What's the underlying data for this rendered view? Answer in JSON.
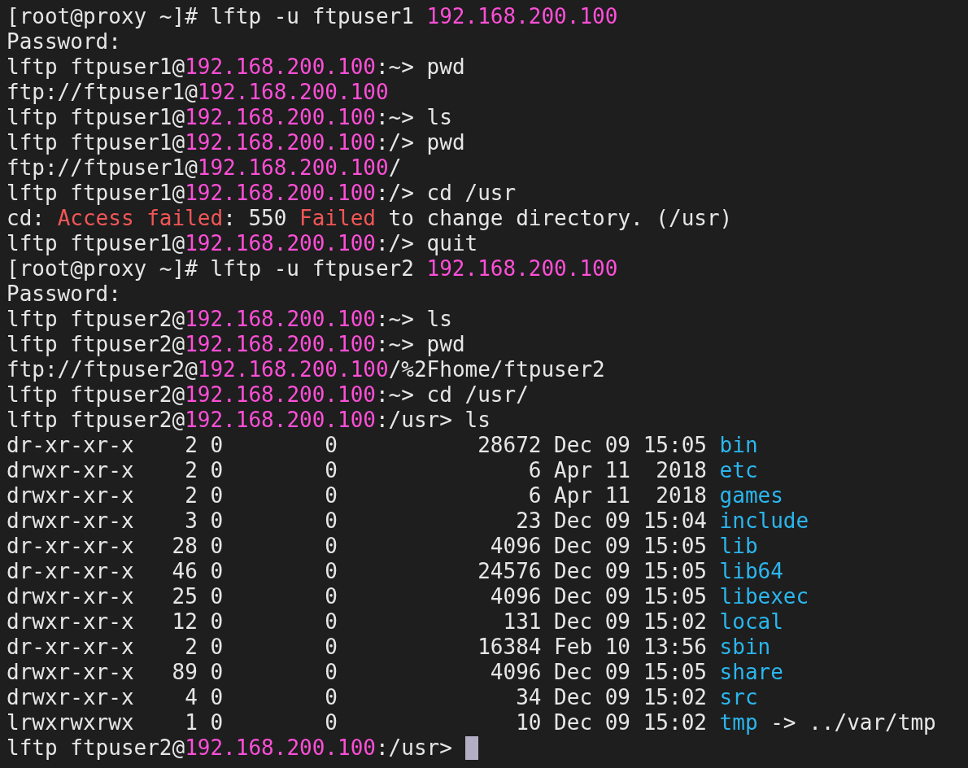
{
  "terminal": {
    "lines": [
      {
        "segments": [
          {
            "text": "[root@proxy ~]# lftp -u ftpuser1 ",
            "kind": "plain"
          },
          {
            "text": "192.168.200.100",
            "kind": "ip"
          }
        ]
      },
      {
        "segments": [
          {
            "text": "Password:",
            "kind": "plain"
          }
        ]
      },
      {
        "segments": [
          {
            "text": "lftp ftpuser1@",
            "kind": "plain"
          },
          {
            "text": "192.168.200.100",
            "kind": "ip"
          },
          {
            "text": ":~> pwd",
            "kind": "plain"
          }
        ]
      },
      {
        "segments": [
          {
            "text": "ftp://ftpuser1@",
            "kind": "plain"
          },
          {
            "text": "192.168.200.100",
            "kind": "ip"
          }
        ]
      },
      {
        "segments": [
          {
            "text": "lftp ftpuser1@",
            "kind": "plain"
          },
          {
            "text": "192.168.200.100",
            "kind": "ip"
          },
          {
            "text": ":~> ls",
            "kind": "plain"
          }
        ]
      },
      {
        "segments": [
          {
            "text": "lftp ftpuser1@",
            "kind": "plain"
          },
          {
            "text": "192.168.200.100",
            "kind": "ip"
          },
          {
            "text": ":/> pwd",
            "kind": "plain"
          }
        ]
      },
      {
        "segments": [
          {
            "text": "ftp://ftpuser1@",
            "kind": "plain"
          },
          {
            "text": "192.168.200.100",
            "kind": "ip"
          },
          {
            "text": "/",
            "kind": "plain"
          }
        ]
      },
      {
        "segments": [
          {
            "text": "lftp ftpuser1@",
            "kind": "plain"
          },
          {
            "text": "192.168.200.100",
            "kind": "ip"
          },
          {
            "text": ":/> cd /usr",
            "kind": "plain"
          }
        ]
      },
      {
        "segments": [
          {
            "text": "cd: ",
            "kind": "plain"
          },
          {
            "text": "Access failed",
            "kind": "error"
          },
          {
            "text": ": 550 ",
            "kind": "plain"
          },
          {
            "text": "Failed",
            "kind": "error"
          },
          {
            "text": " to change directory. (/usr)",
            "kind": "plain"
          }
        ]
      },
      {
        "segments": [
          {
            "text": "lftp ftpuser1@",
            "kind": "plain"
          },
          {
            "text": "192.168.200.100",
            "kind": "ip"
          },
          {
            "text": ":/> quit",
            "kind": "plain"
          }
        ]
      },
      {
        "segments": [
          {
            "text": "[root@proxy ~]# lftp -u ftpuser2 ",
            "kind": "plain"
          },
          {
            "text": "192.168.200.100",
            "kind": "ip"
          }
        ]
      },
      {
        "segments": [
          {
            "text": "Password:",
            "kind": "plain"
          }
        ]
      },
      {
        "segments": [
          {
            "text": "lftp ftpuser2@",
            "kind": "plain"
          },
          {
            "text": "192.168.200.100",
            "kind": "ip"
          },
          {
            "text": ":~> ls",
            "kind": "plain"
          }
        ]
      },
      {
        "segments": [
          {
            "text": "lftp ftpuser2@",
            "kind": "plain"
          },
          {
            "text": "192.168.200.100",
            "kind": "ip"
          },
          {
            "text": ":~> pwd",
            "kind": "plain"
          }
        ]
      },
      {
        "segments": [
          {
            "text": "ftp://ftpuser2@",
            "kind": "plain"
          },
          {
            "text": "192.168.200.100",
            "kind": "ip"
          },
          {
            "text": "/%2Fhome/ftpuser2",
            "kind": "plain"
          }
        ]
      },
      {
        "segments": [
          {
            "text": "lftp ftpuser2@",
            "kind": "plain"
          },
          {
            "text": "192.168.200.100",
            "kind": "ip"
          },
          {
            "text": ":~> cd /usr/",
            "kind": "plain"
          }
        ]
      },
      {
        "segments": [
          {
            "text": "lftp ftpuser2@",
            "kind": "plain"
          },
          {
            "text": "192.168.200.100",
            "kind": "ip"
          },
          {
            "text": ":/usr> ls",
            "kind": "plain"
          }
        ]
      },
      {
        "segments": [
          {
            "text": "dr-xr-xr-x    2 0        0           28672 Dec 09 15:05 ",
            "kind": "plain"
          },
          {
            "text": "bin",
            "kind": "dir"
          }
        ]
      },
      {
        "segments": [
          {
            "text": "drwxr-xr-x    2 0        0               6 Apr 11  2018 ",
            "kind": "plain"
          },
          {
            "text": "etc",
            "kind": "dir"
          }
        ]
      },
      {
        "segments": [
          {
            "text": "drwxr-xr-x    2 0        0               6 Apr 11  2018 ",
            "kind": "plain"
          },
          {
            "text": "games",
            "kind": "dir"
          }
        ]
      },
      {
        "segments": [
          {
            "text": "drwxr-xr-x    3 0        0              23 Dec 09 15:04 ",
            "kind": "plain"
          },
          {
            "text": "include",
            "kind": "dir"
          }
        ]
      },
      {
        "segments": [
          {
            "text": "dr-xr-xr-x   28 0        0            4096 Dec 09 15:05 ",
            "kind": "plain"
          },
          {
            "text": "lib",
            "kind": "dir"
          }
        ]
      },
      {
        "segments": [
          {
            "text": "dr-xr-xr-x   46 0        0           24576 Dec 09 15:05 ",
            "kind": "plain"
          },
          {
            "text": "lib64",
            "kind": "dir"
          }
        ]
      },
      {
        "segments": [
          {
            "text": "drwxr-xr-x   25 0        0            4096 Dec 09 15:05 ",
            "kind": "plain"
          },
          {
            "text": "libexec",
            "kind": "dir"
          }
        ]
      },
      {
        "segments": [
          {
            "text": "drwxr-xr-x   12 0        0             131 Dec 09 15:02 ",
            "kind": "plain"
          },
          {
            "text": "local",
            "kind": "dir"
          }
        ]
      },
      {
        "segments": [
          {
            "text": "dr-xr-xr-x    2 0        0           16384 Feb 10 13:56 ",
            "kind": "plain"
          },
          {
            "text": "sbin",
            "kind": "dir"
          }
        ]
      },
      {
        "segments": [
          {
            "text": "drwxr-xr-x   89 0        0            4096 Dec 09 15:05 ",
            "kind": "plain"
          },
          {
            "text": "share",
            "kind": "dir"
          }
        ]
      },
      {
        "segments": [
          {
            "text": "drwxr-xr-x    4 0        0              34 Dec 09 15:02 ",
            "kind": "plain"
          },
          {
            "text": "src",
            "kind": "dir"
          }
        ]
      },
      {
        "segments": [
          {
            "text": "lrwxrwxrwx    1 0        0              10 Dec 09 15:02 ",
            "kind": "plain"
          },
          {
            "text": "tmp",
            "kind": "dir"
          },
          {
            "text": " -> ../var/tmp",
            "kind": "plain"
          }
        ]
      },
      {
        "segments": [
          {
            "text": "lftp ftpuser2@",
            "kind": "plain"
          },
          {
            "text": "192.168.200.100",
            "kind": "ip"
          },
          {
            "text": ":/usr> ",
            "kind": "plain"
          }
        ],
        "cursor": true
      }
    ]
  }
}
